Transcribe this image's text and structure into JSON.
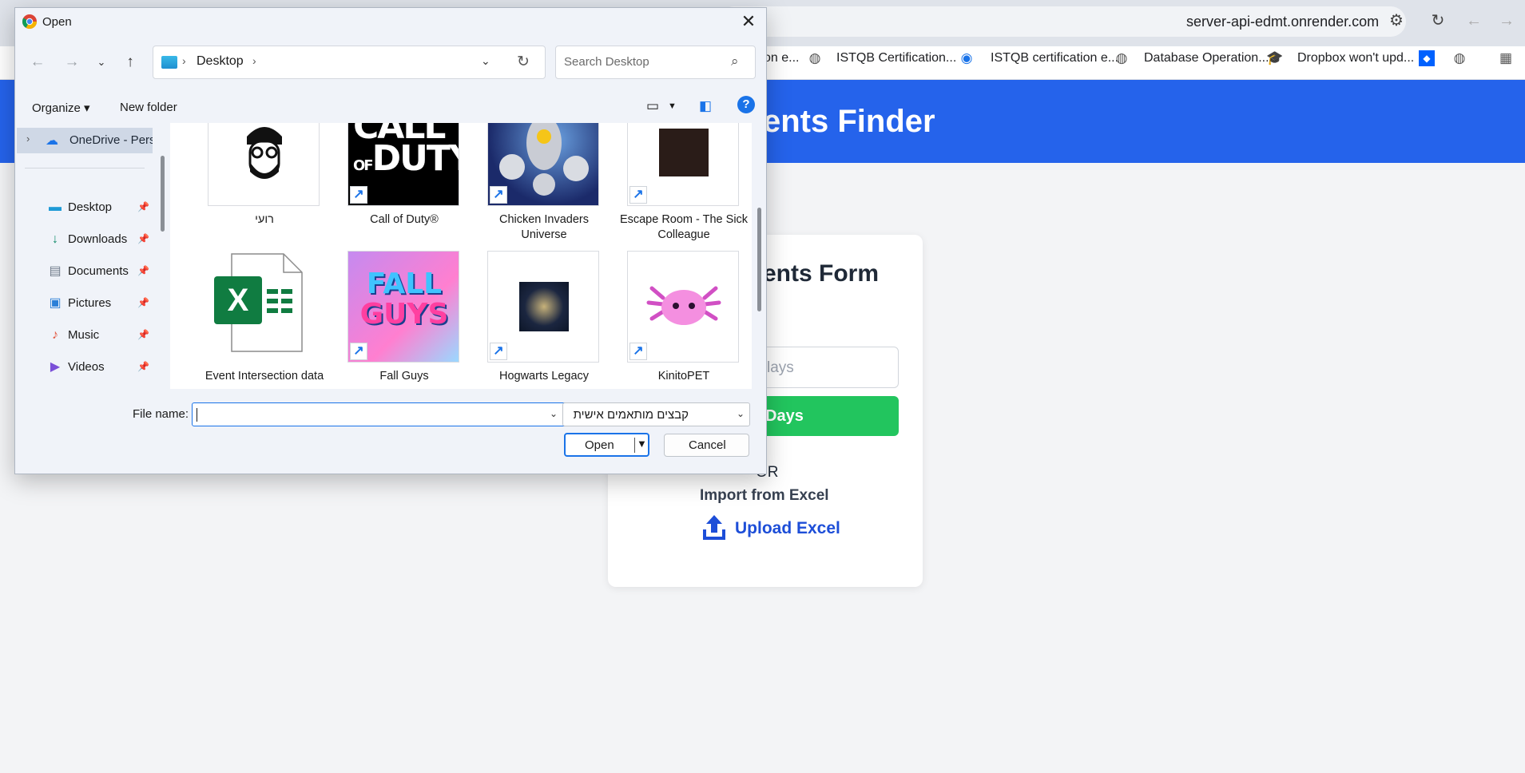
{
  "browser": {
    "url": "server-api-edmt.onrender.com",
    "bookmarks": [
      {
        "label": "on e...",
        "icon": "globe-icon"
      },
      {
        "label": "ISTQB Certification...",
        "icon": "globe-icon"
      },
      {
        "label": "ISTQB certification e...",
        "icon": "edge-icon"
      },
      {
        "label": "Database Operation...",
        "icon": "globe-icon"
      },
      {
        "label": "Dropbox won't upd...",
        "icon": "graduation-cap-icon"
      }
    ]
  },
  "app": {
    "header_title": "ents Finder",
    "form_title": "ents Form",
    "days_placeholder": "lays",
    "days_button": "Days",
    "or_text": "OR",
    "import_text": "Import from Excel",
    "upload_label": "Upload Excel"
  },
  "dialog": {
    "title": "Open",
    "close_glyph": "✕",
    "address": {
      "location": "Desktop",
      "search_placeholder": "Search Desktop"
    },
    "toolbar": {
      "organize": "Organize ▾",
      "new_folder": "New folder",
      "help": "?"
    },
    "nav": {
      "onedrive": "OneDrive - Perso",
      "items": [
        {
          "label": "Desktop",
          "icon": "desktop-icon",
          "color": "#1e9ad6"
        },
        {
          "label": "Downloads",
          "icon": "download-icon",
          "color": "#0f8a6a"
        },
        {
          "label": "Documents",
          "icon": "document-icon",
          "color": "#6f7b8a"
        },
        {
          "label": "Pictures",
          "icon": "pictures-icon",
          "color": "#2b7fd8"
        },
        {
          "label": "Music",
          "icon": "music-icon",
          "color": "#e2553e"
        },
        {
          "label": "Videos",
          "icon": "videos-icon",
          "color": "#7a4fd8"
        }
      ]
    },
    "files": [
      {
        "label": "רועי",
        "type": "avatar"
      },
      {
        "label": "Call of Duty®",
        "type": "cod",
        "shortcut": true
      },
      {
        "label": "Chicken Invaders Universe",
        "type": "chicken",
        "shortcut": true
      },
      {
        "label": "Escape Room - The Sick Colleague",
        "type": "escape",
        "shortcut": true
      },
      {
        "label": "Event Intersection data",
        "type": "excel"
      },
      {
        "label": "Fall Guys",
        "type": "fallguys",
        "shortcut": true
      },
      {
        "label": "Hogwarts Legacy",
        "type": "hogwarts",
        "shortcut": true
      },
      {
        "label": "KinitoPET",
        "type": "kinito",
        "shortcut": true
      }
    ],
    "file_name_label": "File name:",
    "file_name_value": "",
    "file_type": "קבצים מותאמים אישית",
    "open_button": "Open",
    "cancel_button": "Cancel"
  }
}
